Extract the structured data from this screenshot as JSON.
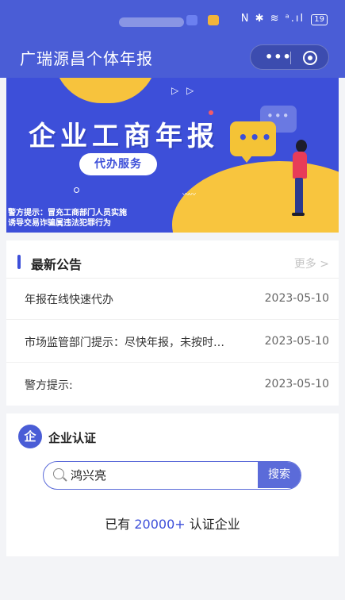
{
  "nav": {
    "title": "广瑞源昌个体年报",
    "more_glyph": "•••"
  },
  "status": {
    "icons": "N ✱ ≋ ᵃ.ıl",
    "battery": "19"
  },
  "banner": {
    "headline": "企业工商年报",
    "pill": "代办服务",
    "warning_line1": "警方提示：冒充工商部门人员实施",
    "warning_line2": "诱导交易诈骗属违法犯罪行为"
  },
  "notice": {
    "title": "最新公告",
    "more": "更多 >",
    "items": [
      {
        "title": "年报在线快速代办",
        "date": "2023-05-10"
      },
      {
        "title": "市场监管部门提示：尽快年报，未按时…",
        "date": "2023-05-10"
      },
      {
        "title": "警方提示:",
        "date": "2023-05-10"
      }
    ]
  },
  "auth": {
    "icon_char": "企",
    "title": "企业认证",
    "search_value": "鸿兴亮",
    "search_button": "搜索",
    "count_prefix": "已有 ",
    "count_value": "20000+",
    "count_suffix": " 认证企业"
  },
  "colors": {
    "primary": "#4a5dd6",
    "accent_yellow": "#f7c33d"
  }
}
